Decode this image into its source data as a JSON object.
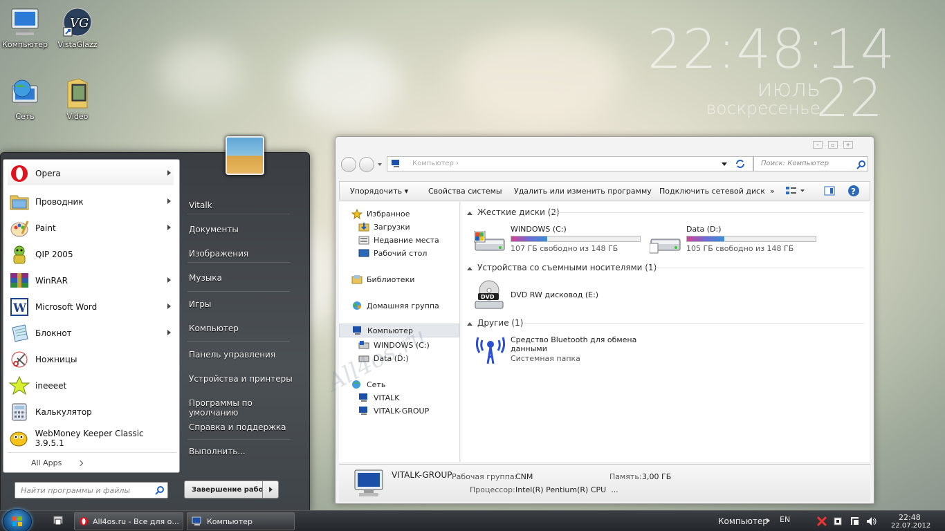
{
  "desktop": {
    "icons": [
      {
        "label": "Компьютер"
      },
      {
        "label": "VistaGlazz"
      },
      {
        "label": "Сеть"
      },
      {
        "label": "Video"
      }
    ],
    "clock": {
      "time": "22:48:14",
      "month": "июль",
      "day_of_week": "воскресенье",
      "day": "22"
    },
    "watermark": "All4os.ru"
  },
  "start_menu": {
    "programs": [
      {
        "label": "Opera",
        "has_submenu": true
      },
      {
        "label": "Проводник",
        "has_submenu": true
      },
      {
        "label": "Paint",
        "has_submenu": true
      },
      {
        "label": "QIP 2005",
        "has_submenu": false
      },
      {
        "label": "WinRAR",
        "has_submenu": true
      },
      {
        "label": "Microsoft Word",
        "has_submenu": true
      },
      {
        "label": "Блокнот",
        "has_submenu": true
      },
      {
        "label": "Ножницы",
        "has_submenu": false
      },
      {
        "label": "ineeeet",
        "has_submenu": false
      },
      {
        "label": "Калькулятор",
        "has_submenu": false
      },
      {
        "label": "WebMoney Keeper Classic 3.9.5.1",
        "has_submenu": false
      }
    ],
    "all_apps": "All Apps",
    "places": [
      "Vitalk",
      "Документы",
      "Изображения",
      "Музыка",
      "Игры",
      "Компьютер",
      "Панель управления",
      "Устройства и принтеры",
      "Программы по умолчанию",
      "Справка и поддержка",
      "Выполнить..."
    ],
    "search_placeholder": "Найти программы и файлы",
    "shutdown_label": "Завершение работы"
  },
  "explorer": {
    "breadcrumb": "Компьютер",
    "search_placeholder": "Поиск: Компьютер",
    "toolbar": {
      "organize": "Упорядочить",
      "system_properties": "Свойства системы",
      "uninstall": "Удалить или изменить программу",
      "map_drive": "Подключить сетевой диск",
      "more": "»"
    },
    "nav": {
      "favorites": "Избранное",
      "downloads": "Загрузки",
      "recent": "Недавние места",
      "desktop": "Рабочий стол",
      "libraries": "Библиотеки",
      "homegroup": "Домашняя группа",
      "computer": "Компьютер",
      "drive_c": "WINDOWS (C:)",
      "drive_d": "Data (D:)",
      "network": "Сеть",
      "net1": "VITALK",
      "net2": "VITALK-GROUP"
    },
    "groups": {
      "hdd": "Жесткие диски (2)",
      "removable": "Устройства со съемными носителями (1)",
      "other": "Другие (1)"
    },
    "drives": [
      {
        "name": "WINDOWS (C:)",
        "free": "107 ГБ свободно из 148 ГБ",
        "used_fraction": 0.28
      },
      {
        "name": "Data (D:)",
        "free": "105 ГБ свободно из 148 ГБ",
        "used_fraction": 0.29
      }
    ],
    "dvd": "DVD RW дисковод (E:)",
    "bluetooth": {
      "name1": "Средство Bluetooth для обмена",
      "name2": "данными",
      "type": "Системная папка"
    },
    "details": {
      "name": "VITALK-GROUP",
      "workgroup_label": "Рабочая группа:",
      "workgroup": "CNM",
      "memory_label": "Память:",
      "memory": "3,00 ГБ",
      "cpu_label": "Процессор:",
      "cpu": "Intel(R) Pentium(R) CPU  ..."
    }
  },
  "taskbar": {
    "buttons": [
      {
        "label": "All4os.ru - Все для о..."
      },
      {
        "label": "Компьютер"
      }
    ],
    "tray_label": "Компьютер",
    "lang": "EN",
    "time": "22:48",
    "date": "22.07.2012"
  }
}
